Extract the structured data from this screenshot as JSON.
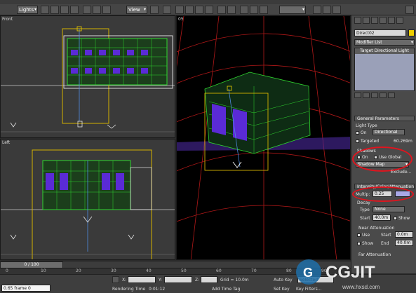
{
  "menu": {
    "items": [
      "",
      "",
      "",
      "",
      "",
      "",
      "",
      "",
      "",
      "",
      "",
      "",
      "",
      "",
      "",
      "",
      "",
      ""
    ]
  },
  "toolbar": {
    "filter_value": "Lights",
    "view_value": "View"
  },
  "viewports": {
    "top_left_label": "Front",
    "bottom_left_label": "Left",
    "right_label": "05"
  },
  "command_panel": {
    "object_name": "Direct02",
    "object_color": "#f0d000",
    "modifier_list": "Modifier List",
    "stack_item": "Target Directional Light",
    "general_parameters": {
      "title": "General Parameters",
      "light_type_label": "Light Type",
      "on_label": "On",
      "light_type_value": "Directional",
      "targeted_label": "Targeted",
      "target_distance": "60.269m",
      "shadows_label": "Shadows",
      "shadows_on_label": "On",
      "use_global_label": "Use Global",
      "shadow_type": "Shadow Map",
      "exclude_button": "Exclude..."
    },
    "intensity": {
      "title": "Intensity/Color/Attenuation",
      "multiplier_label": "Multip:",
      "multiplier_value": "0.25",
      "color_swatch": "#a9a8e6",
      "decay_label": "Decay",
      "type_label": "Type",
      "type_value": "None",
      "start_label": "Start",
      "start_value": "40.0m",
      "show_label": "Show",
      "near_label": "Near Attenuation",
      "use_label": "Use",
      "near_start_label": "Start",
      "near_start_value": "0.0m",
      "near_show_label": "Show",
      "near_end_label": "End",
      "near_end_value": "40.0m",
      "far_label": "Far Attenuation"
    }
  },
  "timeline": {
    "position": "0 / 100"
  },
  "ruler_ticks": [
    "0",
    "10",
    "20",
    "30",
    "40",
    "50",
    "60",
    "70",
    "80",
    "90"
  ],
  "status": {
    "x_label": "X:",
    "x_value": "",
    "y_label": "Y:",
    "y_value": "",
    "z_label": "Z:",
    "z_value": "",
    "grid": "Grid = 10.0m",
    "rendering_time_label": "Rendering Time",
    "rendering_time": "0:01:12",
    "add_time_tag": "Add Time Tag",
    "auto_key": "Auto Key",
    "selected": "Selected",
    "set_key": "Set Key",
    "key_filters": "Key Filters...",
    "prompt": "0.65 frame 0"
  },
  "watermark": {
    "brand": "CGJIT",
    "site": "www.hxsd.com"
  }
}
